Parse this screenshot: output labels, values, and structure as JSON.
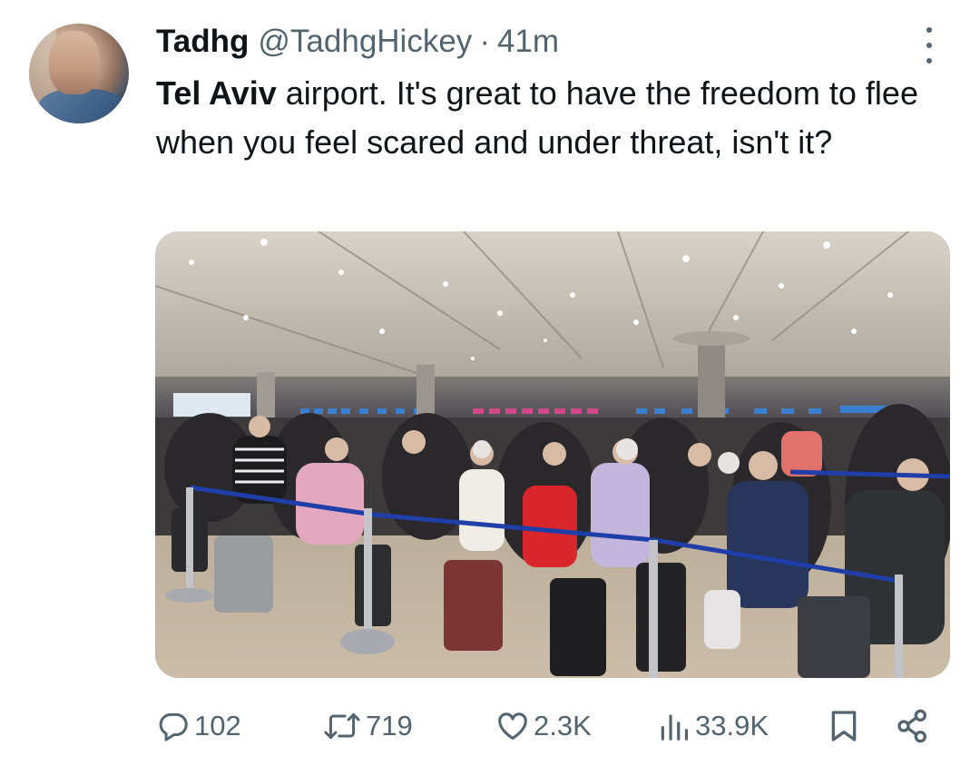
{
  "tweet": {
    "display_name": "Tadhg",
    "handle": "@TadhgHickey",
    "separator": "·",
    "time": "41m",
    "text_bold": "Tel Aviv",
    "text_rest": " airport. It's great to have the freedom to flee when you feel scared and under threat, isn't it?"
  },
  "actions": {
    "replies": "102",
    "retweets": "719",
    "likes": "2.3K",
    "views": "33.9K"
  },
  "icons": {
    "reply": "speech-bubble-icon",
    "retweet": "retweet-arrows-icon",
    "like": "heart-icon",
    "views": "bar-chart-icon",
    "bookmark": "bookmark-icon",
    "share": "share-icon",
    "more": "vertical-dots-icon"
  },
  "colors": {
    "text": "#0f1419",
    "secondary": "#536471"
  }
}
